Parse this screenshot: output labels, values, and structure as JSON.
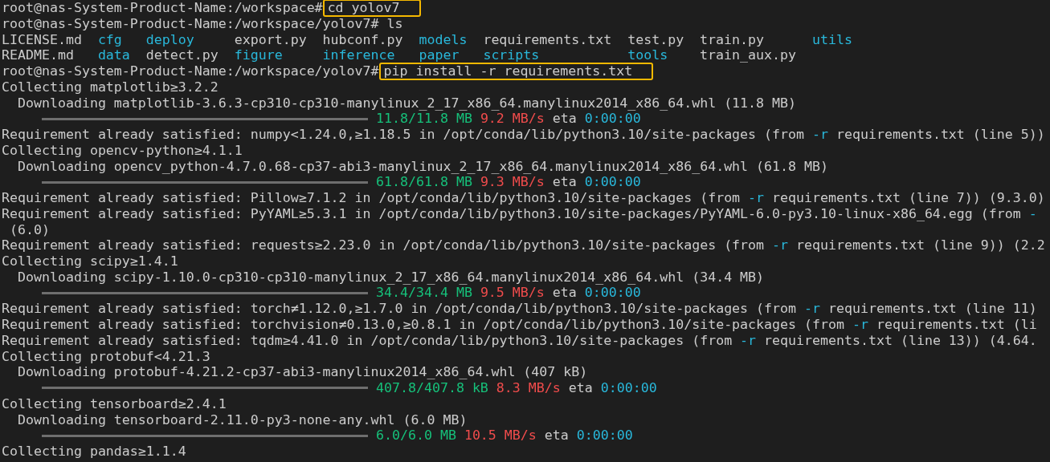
{
  "terminal": {
    "lines": [
      {
        "kind": "prompt",
        "prompt": "root@nas-System-Product-Name:/workspace#",
        "command": "cd yolov7",
        "highlighted": true
      },
      {
        "kind": "prompt",
        "prompt": "root@nas-System-Product-Name:/workspace/yolov7#",
        "command": "ls",
        "highlighted": false
      },
      {
        "kind": "ls",
        "entries": [
          {
            "name": "LICENSE.md",
            "kind": "file"
          },
          {
            "name": "cfg",
            "kind": "dir"
          },
          {
            "name": "deploy",
            "kind": "dir"
          },
          {
            "name": "export.py",
            "kind": "file"
          },
          {
            "name": "hubconf.py",
            "kind": "file"
          },
          {
            "name": "models",
            "kind": "dir"
          },
          {
            "name": "requirements.txt",
            "kind": "file"
          },
          {
            "name": "test.py",
            "kind": "file"
          },
          {
            "name": "train.py",
            "kind": "file"
          },
          {
            "name": "utils",
            "kind": "dir"
          }
        ]
      },
      {
        "kind": "ls",
        "entries": [
          {
            "name": "README.md",
            "kind": "file"
          },
          {
            "name": "data",
            "kind": "dir"
          },
          {
            "name": "detect.py",
            "kind": "file"
          },
          {
            "name": "figure",
            "kind": "dir"
          },
          {
            "name": "inference",
            "kind": "dir"
          },
          {
            "name": "paper",
            "kind": "dir"
          },
          {
            "name": "scripts",
            "kind": "dir"
          },
          {
            "name": "tools",
            "kind": "dir"
          },
          {
            "name": "train_aux.py",
            "kind": "file"
          }
        ]
      },
      {
        "kind": "prompt",
        "prompt": "root@nas-System-Product-Name:/workspace/yolov7#",
        "command": "pip install -r requirements.txt",
        "highlighted": true
      },
      {
        "kind": "text",
        "segments": [
          {
            "text": "Collecting matplotlib≥3.2.2",
            "color": "#cccccc"
          }
        ]
      },
      {
        "kind": "text",
        "segments": [
          {
            "text": "  Downloading matplotlib-3.6.3-cp310-cp310-manylinux_2_17_x86_64.manylinux2014_x86_64.whl (11.8 MB)",
            "color": "#cccccc"
          }
        ]
      },
      {
        "kind": "progress",
        "level": 1,
        "done": "11.8/11.8 MB",
        "speed": "9.2 MB/s",
        "eta_label": "eta",
        "eta": "0:00:00"
      },
      {
        "kind": "text",
        "segments": [
          {
            "text": "Requirement already satisfied: numpy<1.24.0,≥1.18.5 in /opt/conda/lib/python3.10/site-packages (from ",
            "color": "#cccccc"
          },
          {
            "text": "-r",
            "color": "#29b8db"
          },
          {
            "text": " requirements.txt (line 5))",
            "color": "#cccccc"
          }
        ]
      },
      {
        "kind": "text",
        "segments": [
          {
            "text": "Collecting opencv-python≥4.1.1",
            "color": "#cccccc"
          }
        ]
      },
      {
        "kind": "text",
        "segments": [
          {
            "text": "  Downloading opencv_python-4.7.0.68-cp37-abi3-manylinux_2_17_x86_64.manylinux2014_x86_64.whl (61.8 MB)",
            "color": "#cccccc"
          }
        ]
      },
      {
        "kind": "progress",
        "level": 1,
        "done": "61.8/61.8 MB",
        "speed": "9.3 MB/s",
        "eta_label": "eta",
        "eta": "0:00:00"
      },
      {
        "kind": "text",
        "segments": [
          {
            "text": "Requirement already satisfied: Pillow≥7.1.2 in /opt/conda/lib/python3.10/site-packages (from ",
            "color": "#cccccc"
          },
          {
            "text": "-r",
            "color": "#29b8db"
          },
          {
            "text": " requirements.txt (line 7)) (9.3.0)",
            "color": "#cccccc"
          }
        ]
      },
      {
        "kind": "text",
        "segments": [
          {
            "text": "Requirement already satisfied: PyYAML≥5.3.1 in /opt/conda/lib/python3.10/site-packages/PyYAML-6.0-py3.10-linux-x86_64.egg (from ",
            "color": "#cccccc"
          },
          {
            "text": "-",
            "color": "#29b8db"
          }
        ]
      },
      {
        "kind": "text",
        "segments": [
          {
            "text": " (6.0)",
            "color": "#cccccc"
          }
        ]
      },
      {
        "kind": "text",
        "segments": [
          {
            "text": "Requirement already satisfied: requests≥2.23.0 in /opt/conda/lib/python3.10/site-packages (from ",
            "color": "#cccccc"
          },
          {
            "text": "-r",
            "color": "#29b8db"
          },
          {
            "text": " requirements.txt (line 9)) (2.2",
            "color": "#cccccc"
          }
        ]
      },
      {
        "kind": "text",
        "segments": [
          {
            "text": "Collecting scipy≥1.4.1",
            "color": "#cccccc"
          }
        ]
      },
      {
        "kind": "text",
        "segments": [
          {
            "text": "  Downloading scipy-1.10.0-cp310-cp310-manylinux_2_17_x86_64.manylinux2014_x86_64.whl (34.4 MB)",
            "color": "#cccccc"
          }
        ]
      },
      {
        "kind": "progress",
        "level": 1,
        "done": "34.4/34.4 MB",
        "speed": "9.5 MB/s",
        "eta_label": "eta",
        "eta": "0:00:00"
      },
      {
        "kind": "text",
        "segments": [
          {
            "text": "Requirement already satisfied: torch≠1.12.0,≥1.7.0 in /opt/conda/lib/python3.10/site-packages (from ",
            "color": "#cccccc"
          },
          {
            "text": "-r",
            "color": "#29b8db"
          },
          {
            "text": " requirements.txt (line 11)",
            "color": "#cccccc"
          }
        ]
      },
      {
        "kind": "text",
        "segments": [
          {
            "text": "Requirement already satisfied: torchvision≠0.13.0,≥0.8.1 in /opt/conda/lib/python3.10/site-packages (from ",
            "color": "#cccccc"
          },
          {
            "text": "-r",
            "color": "#29b8db"
          },
          {
            "text": " requirements.txt (li",
            "color": "#cccccc"
          }
        ]
      },
      {
        "kind": "text",
        "segments": [
          {
            "text": "Requirement already satisfied: tqdm≥4.41.0 in /opt/conda/lib/python3.10/site-packages (from ",
            "color": "#cccccc"
          },
          {
            "text": "-r",
            "color": "#29b8db"
          },
          {
            "text": " requirements.txt (line 13)) (4.64.",
            "color": "#cccccc"
          }
        ]
      },
      {
        "kind": "text",
        "segments": [
          {
            "text": "Collecting protobuf<4.21.3",
            "color": "#cccccc"
          }
        ]
      },
      {
        "kind": "text",
        "segments": [
          {
            "text": "  Downloading protobuf-4.21.2-cp37-abi3-manylinux2014_x86_64.whl (407 kB)",
            "color": "#cccccc"
          }
        ]
      },
      {
        "kind": "progress",
        "level": 1,
        "done": "407.8/407.8 kB",
        "speed": "8.3 MB/s",
        "eta_label": "eta",
        "eta": "0:00:00"
      },
      {
        "kind": "text",
        "segments": [
          {
            "text": "Collecting tensorboard≥2.4.1",
            "color": "#cccccc"
          }
        ]
      },
      {
        "kind": "text",
        "segments": [
          {
            "text": "  Downloading tensorboard-2.11.0-py3-none-any.whl (6.0 MB)",
            "color": "#cccccc"
          }
        ]
      },
      {
        "kind": "progress",
        "level": 1,
        "done": "6.0/6.0 MB",
        "speed": "10.5 MB/s",
        "eta_label": "eta",
        "eta": "0:00:00"
      },
      {
        "kind": "text",
        "segments": [
          {
            "text": "Collecting pandas≥1.1.4",
            "color": "#cccccc"
          }
        ]
      }
    ]
  }
}
